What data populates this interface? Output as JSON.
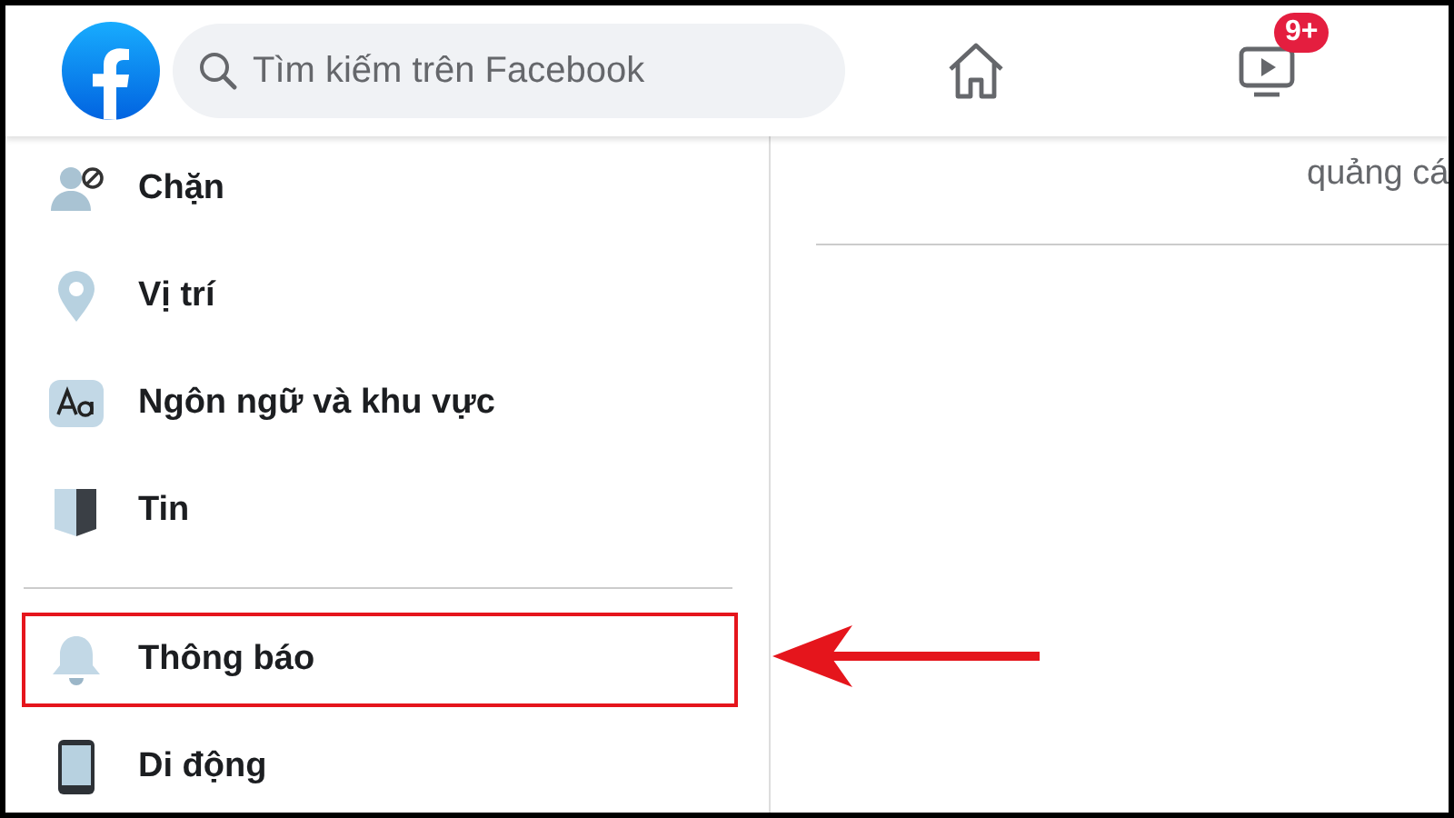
{
  "header": {
    "search": {
      "placeholder": "Tìm kiếm trên Facebook"
    },
    "nav": [
      {
        "kind": "home"
      },
      {
        "kind": "watch",
        "badge": "9+"
      }
    ]
  },
  "sidebar": {
    "sections": [
      {
        "items": [
          {
            "label": "Chặn",
            "highlighted": false
          },
          {
            "label": "Vị trí",
            "highlighted": false
          },
          {
            "label": "Ngôn ngữ và khu vực",
            "highlighted": false
          },
          {
            "label": "Tin",
            "highlighted": false
          }
        ]
      },
      {
        "items": [
          {
            "label": "Thông báo",
            "highlighted": true
          },
          {
            "label": "Di động",
            "highlighted": false
          }
        ]
      }
    ]
  },
  "content": {
    "description_fragment": "quảng cá"
  }
}
